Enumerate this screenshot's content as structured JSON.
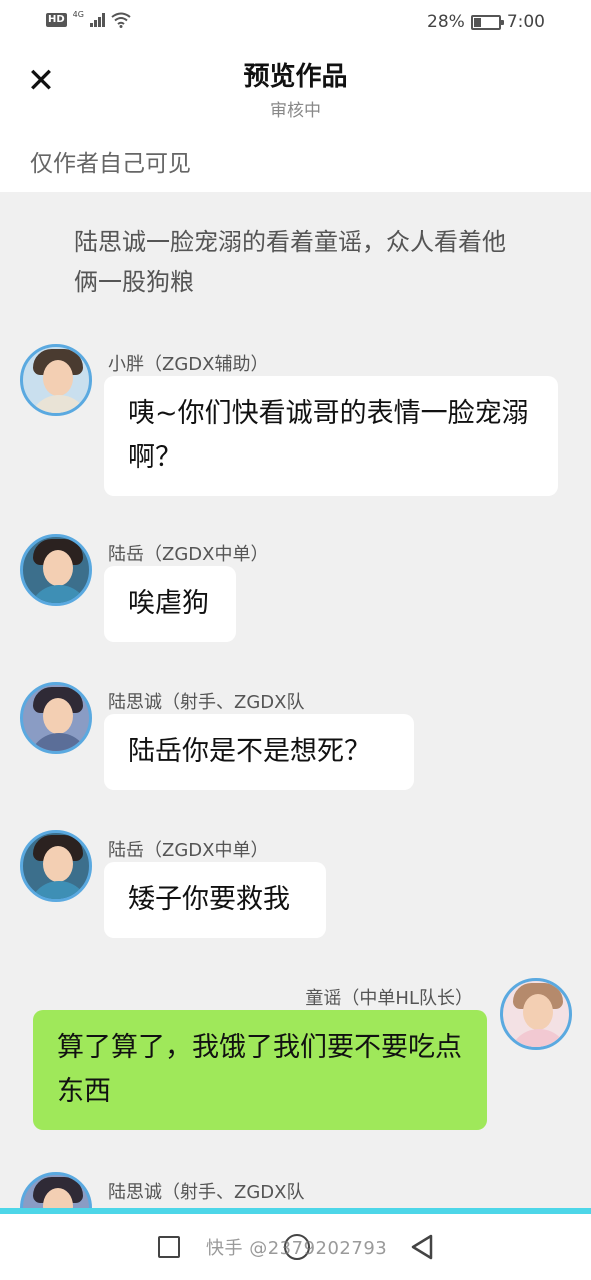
{
  "status_bar": {
    "hd_label": "HD",
    "network_label": "4G",
    "battery_percent": "28%",
    "battery_level": 0.28,
    "time": "7:00",
    "icons": [
      "hd-icon",
      "signal-icon",
      "wifi-icon",
      "battery-charging-icon"
    ]
  },
  "header": {
    "close_icon": "close-icon",
    "title": "预览作品",
    "subtitle": "审核中"
  },
  "visibility": {
    "text": "仅作者自己可见"
  },
  "narration": "陆思诚一脸宠溺的看着童谣，众人看着他俩一股狗粮",
  "messages": [
    {
      "sender": "小胖（ZGDX辅助）",
      "text": "咦~你们快看诚哥的表情一脸宠溺啊？",
      "side": "left",
      "avatar": "avatar-xiaopang"
    },
    {
      "sender": "陆岳（ZGDX中单）",
      "text": "唉虐狗",
      "side": "left",
      "avatar": "avatar-luyue"
    },
    {
      "sender": "陆思诚（射手、ZGDX队",
      "text": "陆岳你是不是想死？",
      "side": "left",
      "avatar": "avatar-lusicheng"
    },
    {
      "sender": "陆岳（ZGDX中单）",
      "text": "矮子你要救我",
      "side": "left",
      "avatar": "avatar-luyue"
    },
    {
      "sender": "童谣（中单HL队长）",
      "text": "算了算了，我饿了我们要不要吃点东西",
      "side": "right",
      "avatar": "avatar-tongyao"
    },
    {
      "sender": "陆思诚（射手、ZGDX队",
      "text": "",
      "side": "left",
      "avatar": "avatar-lusicheng"
    }
  ],
  "colors": {
    "mine_bubble": "#9fe85a",
    "other_bubble": "#ffffff",
    "avatar_border": "#5aa9e0",
    "nav_strip": "#4dd6e8"
  },
  "nav": {
    "icons": [
      "recent-apps-icon",
      "home-icon",
      "back-icon"
    ],
    "watermark": "快手 @2379202793"
  }
}
